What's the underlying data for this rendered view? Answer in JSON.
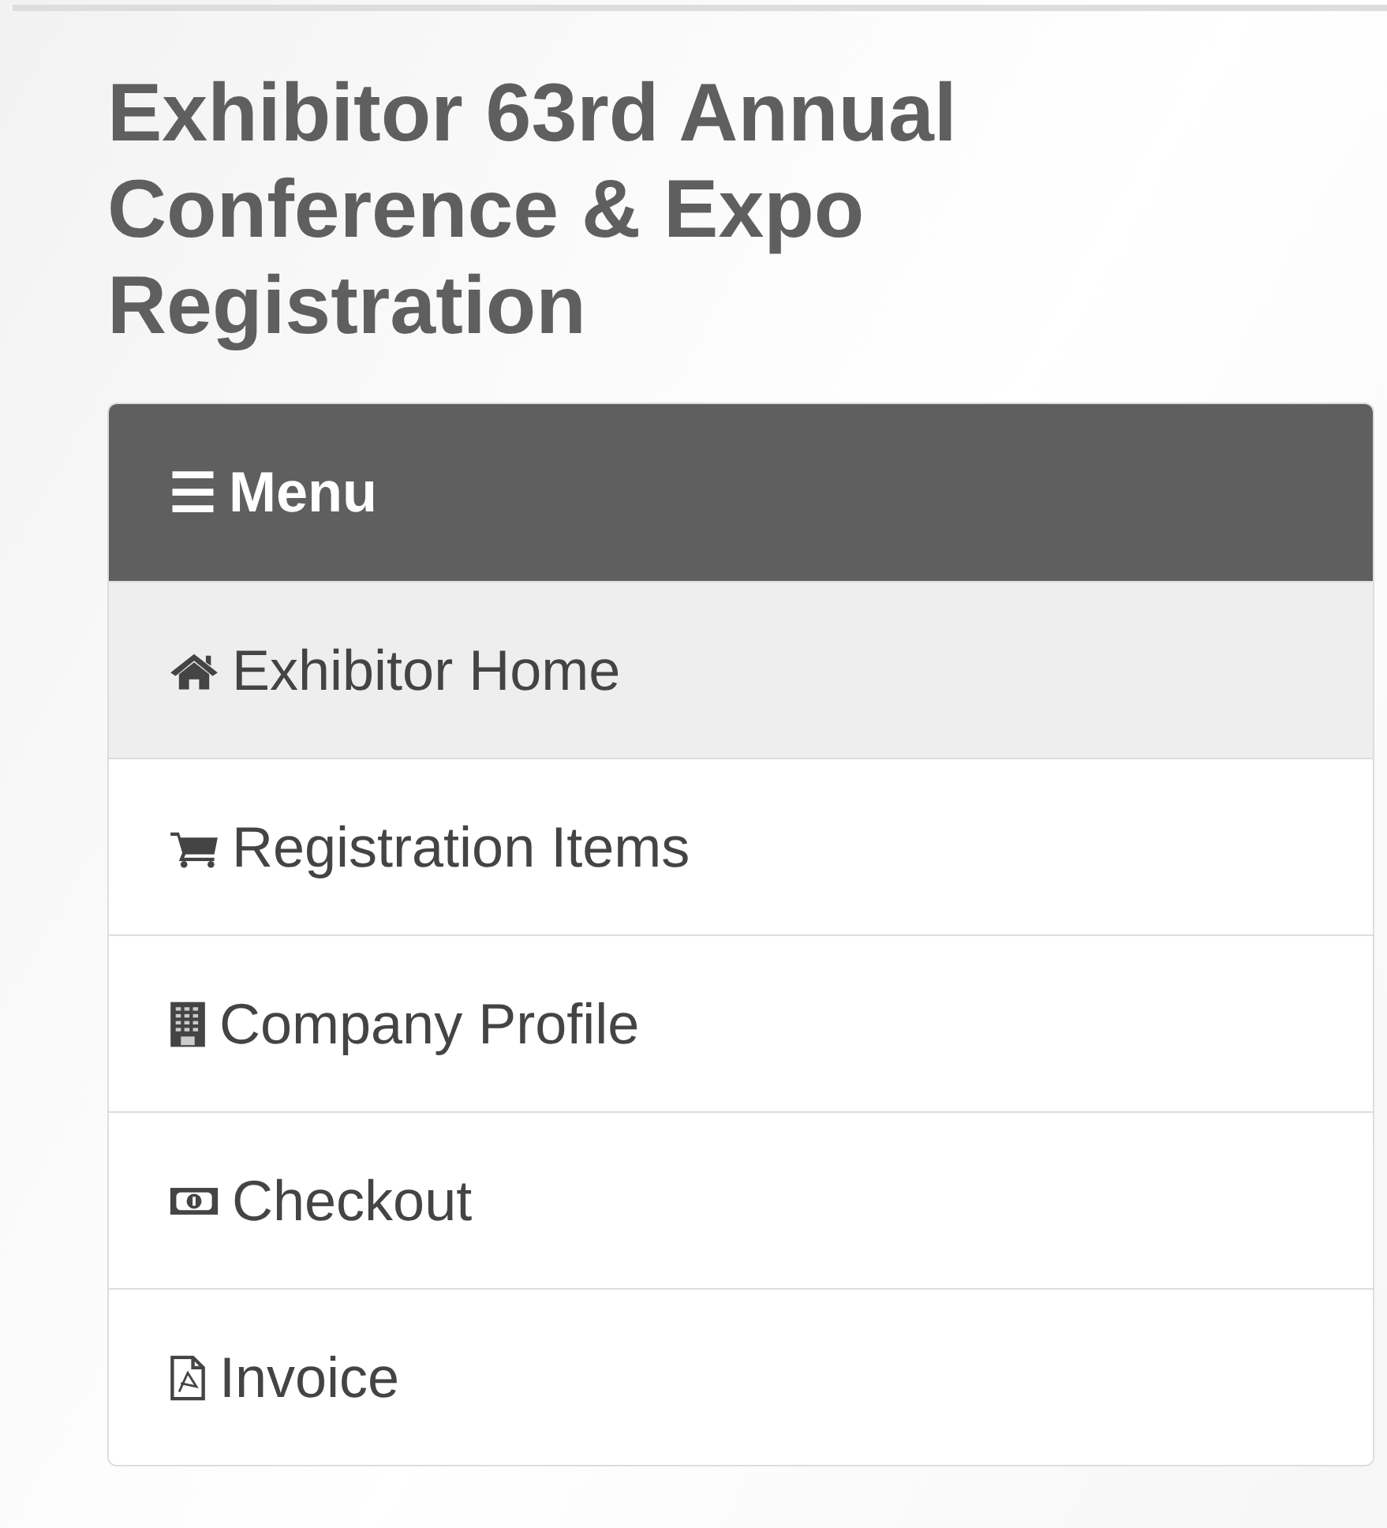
{
  "title": "Exhibitor 63rd Annual Conference & Expo Registration",
  "menu": {
    "icon": "☰",
    "label": "Menu"
  },
  "items": [
    {
      "kind": "home",
      "label": "Exhibitor Home",
      "selected": true
    },
    {
      "kind": "cart",
      "label": "Registration Items",
      "selected": false
    },
    {
      "kind": "building",
      "label": "Company Profile",
      "selected": false
    },
    {
      "kind": "money",
      "label": "Checkout",
      "selected": false
    },
    {
      "kind": "pdf",
      "label": "Invoice",
      "selected": false
    }
  ]
}
